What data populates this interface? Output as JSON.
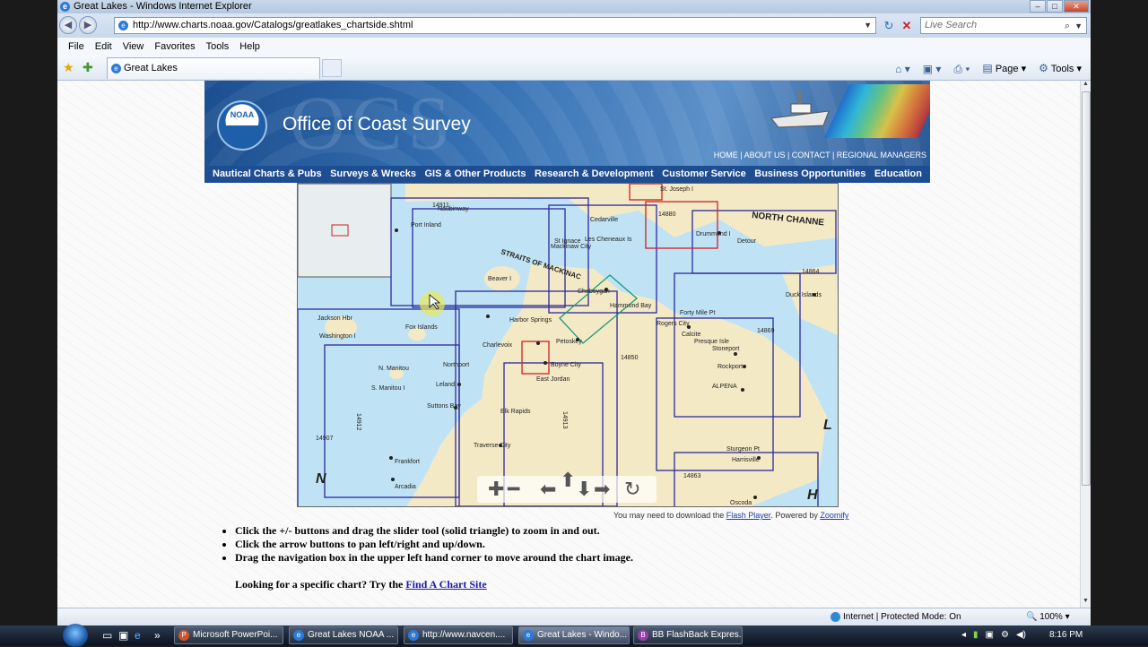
{
  "window": {
    "title": "Great Lakes - Windows Internet Explorer"
  },
  "toolbar": {
    "url": "http://www.charts.noaa.gov/Catalogs/greatlakes_chartside.shtml",
    "search_placeholder": "Live Search"
  },
  "menu": [
    "File",
    "Edit",
    "View",
    "Favorites",
    "Tools",
    "Help"
  ],
  "tab": {
    "label": "Great Lakes"
  },
  "commandbar": {
    "page": "Page",
    "tools": "Tools"
  },
  "banner": {
    "title": "Office of Coast Survey",
    "watermark": "OCS",
    "logo": "NOAA",
    "links": "HOME | ABOUT US | CONTACT | REGIONAL MANAGERS"
  },
  "nav": [
    "Nautical Charts & Pubs",
    "Surveys & Wrecks",
    "GIS & Other Products",
    "Research & Development",
    "Customer Service",
    "Business Opportunities",
    "Education"
  ],
  "map": {
    "labels": {
      "straits": "STRAITS OF MACKINAC",
      "north_channel": "NORTH CHANNE",
      "beaver": "Beaver I",
      "fox": "Fox Islands",
      "jackson": "Jackson Hbr",
      "washington": "Washington I",
      "nmanitou": "N. Manitou",
      "smanitou": "S. Manitou I",
      "northport": "Northport",
      "leland": "Leland",
      "suttons": "Suttons Bay",
      "elk": "Elk Rapids",
      "traverse": "Traverse City",
      "frankfort": "Frankfort",
      "arcadia": "Arcadia",
      "charlevoix": "Charlevoix",
      "harbor": "Harbor Springs",
      "petoskey": "Petoskey",
      "boyne": "Boyne City",
      "eastjordan": "East Jordan",
      "cheboygan": "Cheboygan",
      "hammond": "Hammond Bay",
      "rogers": "Rogers City",
      "presque": "Presque Isle",
      "alpena": "ALPENA",
      "harrisville": "Harrisville",
      "sturgeon": "Sturgeon Pt",
      "oscoda": "Oscoda",
      "duck": "Duck Islands",
      "drummond": "Drummond I",
      "detour": "Detour",
      "mackinaw": "Mackinaw City",
      "stignace": "St Ignace",
      "naubinway": "Naubinway",
      "portinland": "Port Inland",
      "lescheneaux": "Les Cheneaux Is",
      "stjoseph": "St. Joseph I",
      "cedarville": "Cedarville",
      "rockport": "Rockport",
      "forty": "Forty Mile Pt",
      "calcite": "Calcite",
      "stoneport": "Stoneport",
      "letter_n": "N",
      "letter_l": "L",
      "letter_h": "H",
      "num1": "14911",
      "num2": "14880",
      "num3": "14864",
      "num4": "14869",
      "num5": "14850",
      "num6": "14907",
      "num7": "14863",
      "num8": "14912",
      "num9": "14913"
    }
  },
  "map_note": {
    "prefix": "You may need to download the",
    "flash": "Flash Player",
    "mid": ". Powered by",
    "zoomify": "Zoomify"
  },
  "instructions": [
    "Click the +/- buttons and drag the slider tool (solid triangle) to zoom in and out.",
    "Click the arrow buttons to pan left/right and up/down.",
    "Drag the navigation box in the upper left hand corner to move around the chart image."
  ],
  "looking": {
    "text": "Looking for a specific chart? Try the",
    "link": "Find A Chart Site"
  },
  "status": {
    "zone": "Internet | Protected Mode: On",
    "zoom": "100%"
  },
  "taskbar": {
    "items": [
      "Microsoft PowerPoi...",
      "Great Lakes NOAA ...",
      "http://www.navcen....",
      "Great Lakes - Windo...",
      "BB FlashBack Expres..."
    ],
    "clock": "8:16 PM"
  }
}
